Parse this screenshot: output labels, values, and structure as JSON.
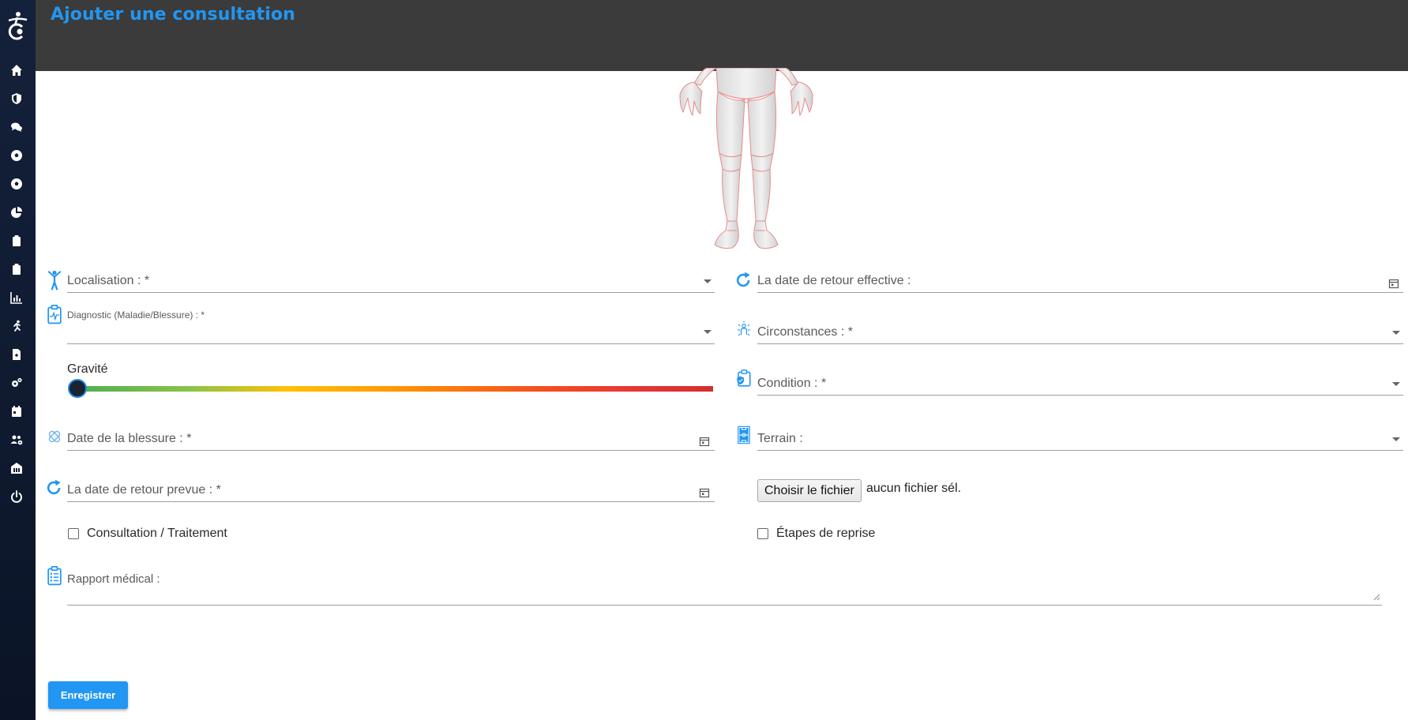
{
  "header": {
    "title": "Ajouter une consultation"
  },
  "sidebar": {
    "items": [
      {
        "icon": "home-icon"
      },
      {
        "icon": "shield-icon"
      },
      {
        "icon": "chat-icon"
      },
      {
        "icon": "soccer-ball-icon"
      },
      {
        "icon": "soccer-ball-icon"
      },
      {
        "icon": "pie-chart-icon"
      },
      {
        "icon": "clipboard-icon"
      },
      {
        "icon": "clipboard-icon"
      },
      {
        "icon": "bar-chart-icon"
      },
      {
        "icon": "running-icon"
      },
      {
        "icon": "file-medical-icon"
      },
      {
        "icon": "gears-icon"
      },
      {
        "icon": "calendar-icon"
      },
      {
        "icon": "users-cog-icon"
      },
      {
        "icon": "building-icon"
      },
      {
        "icon": "power-icon"
      }
    ]
  },
  "form": {
    "localisation": {
      "label": "Localisation : *"
    },
    "diagnostic": {
      "label": "Diagnostic (Maladie/Blessure) : *"
    },
    "gravite": {
      "label": "Gravité",
      "value": 0
    },
    "date_blessure": {
      "label": "Date de la blessure : *"
    },
    "date_retour_prevue": {
      "label": "La date de retour prevue : *"
    },
    "date_retour_effective": {
      "label": "La date de retour effective :"
    },
    "circonstances": {
      "label": "Circonstances : *"
    },
    "condition": {
      "label": "Condition : *"
    },
    "terrain": {
      "label": "Terrain :"
    },
    "file": {
      "button_label": "Choisir le fichier",
      "status": "aucun fichier sél."
    },
    "consultation_traitement": {
      "label": "Consultation / Traitement",
      "checked": false
    },
    "etapes_reprise": {
      "label": "Étapes de reprise",
      "checked": false
    },
    "rapport": {
      "label": "Rapport médical :"
    },
    "save_label": "Enregistrer"
  },
  "colors": {
    "accent": "#2196f3",
    "header_bg": "#3b3b3b",
    "sidebar_bg": "#14213a"
  }
}
